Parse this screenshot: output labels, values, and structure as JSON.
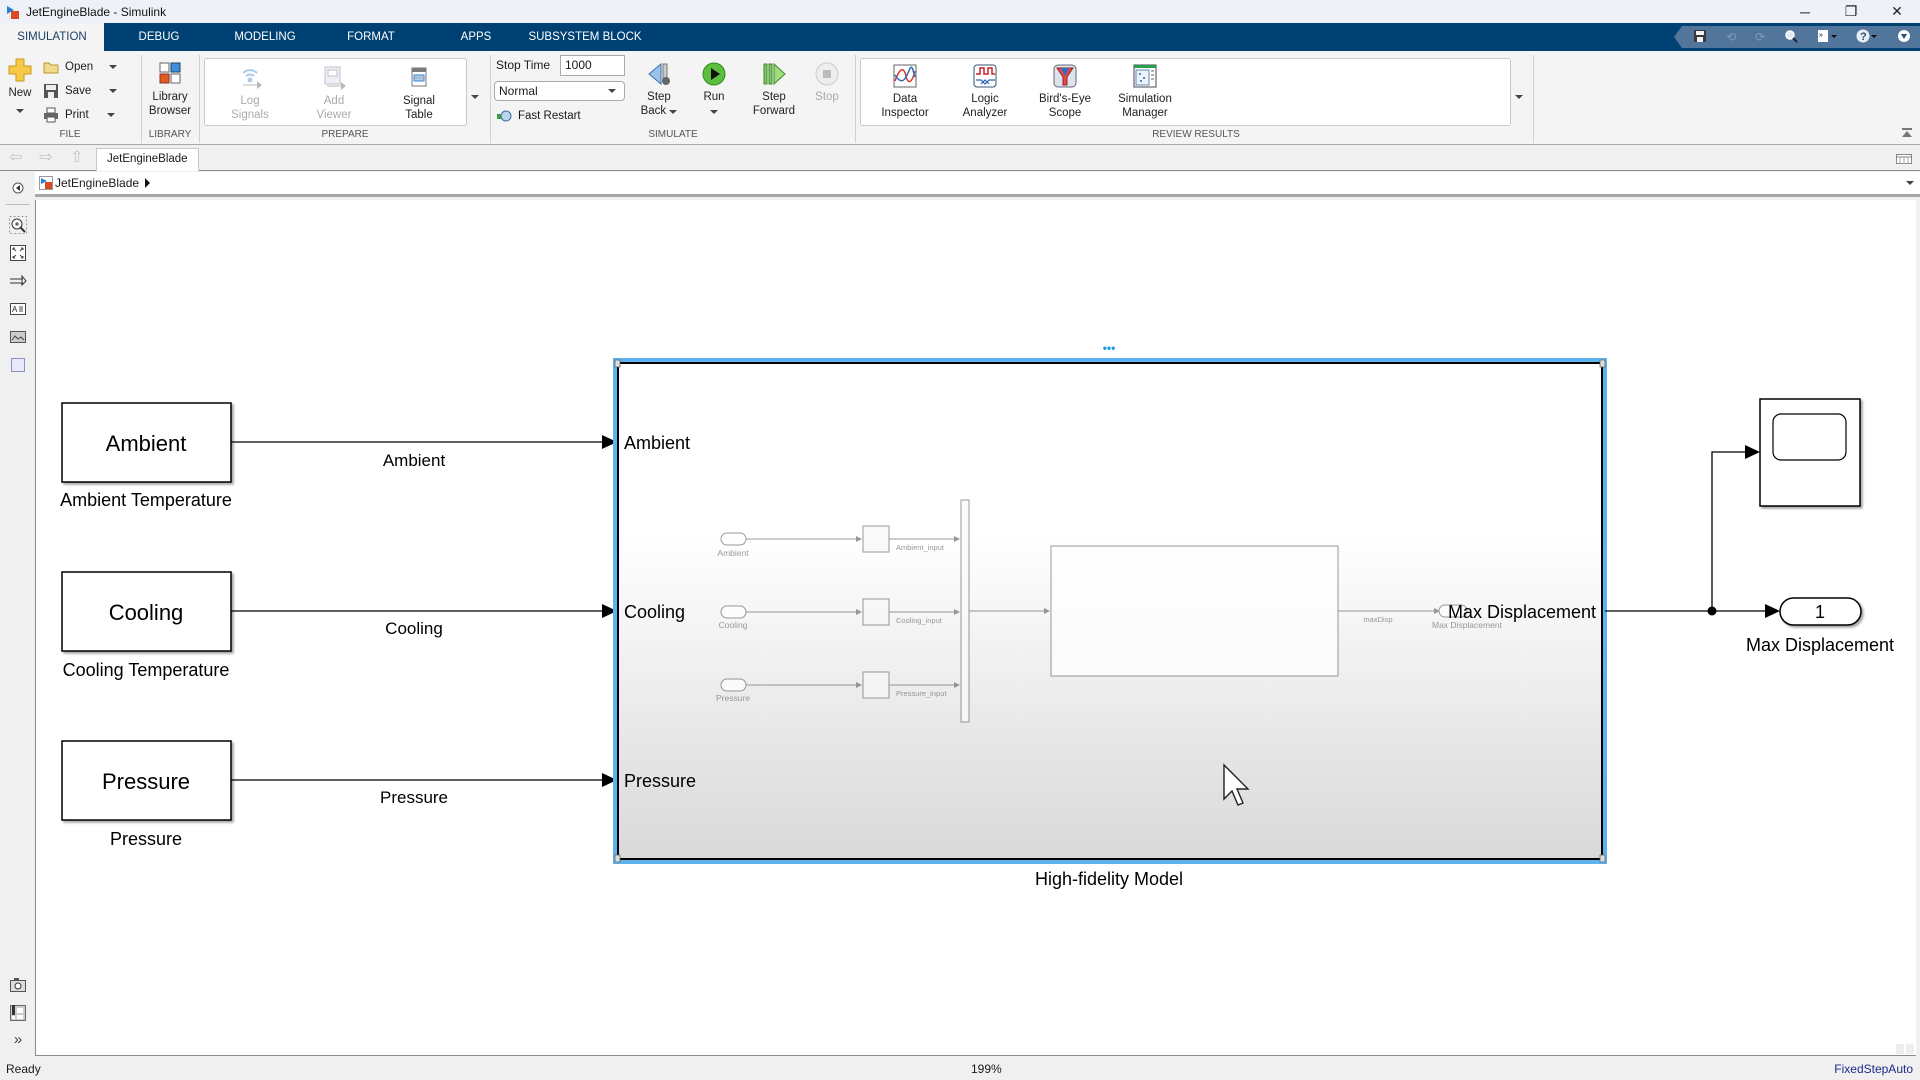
{
  "window": {
    "title": "JetEngineBlade - Simulink",
    "controls": {
      "minimize": "─",
      "restore": "❐",
      "close": "✕"
    }
  },
  "ribbon": {
    "tabs": [
      {
        "label": "SIMULATION",
        "active": true
      },
      {
        "label": "DEBUG",
        "active": false
      },
      {
        "label": "MODELING",
        "active": false
      },
      {
        "label": "FORMAT",
        "active": false
      },
      {
        "label": "APPS",
        "active": false
      },
      {
        "label": "SUBSYSTEM BLOCK",
        "active": false
      }
    ],
    "quick_access": [
      "save-icon",
      "undo-icon",
      "redo-icon",
      "search-icon",
      "shortcut-icon",
      "help-icon",
      "collapse-icon"
    ],
    "sections": {
      "file": {
        "label": "FILE",
        "new_label": "New",
        "open_label": "Open",
        "save_label": "Save",
        "print_label": "Print"
      },
      "library": {
        "label": "LIBRARY",
        "library_browser_line1": "Library",
        "library_browser_line2": "Browser"
      },
      "prepare": {
        "label": "PREPARE",
        "log_signals_line1": "Log",
        "log_signals_line2": "Signals",
        "add_viewer_line1": "Add",
        "add_viewer_line2": "Viewer",
        "signal_table_line1": "Signal",
        "signal_table_line2": "Table"
      },
      "simulate": {
        "label": "SIMULATE",
        "stop_time_label": "Stop Time",
        "stop_time_value": "1000",
        "mode_value": "Normal",
        "fast_restart_label": "Fast Restart",
        "step_back_line1": "Step",
        "step_back_line2": "Back",
        "run_label": "Run",
        "step_forward_line1": "Step",
        "step_forward_line2": "Forward",
        "stop_label": "Stop"
      },
      "review_results": {
        "label": "REVIEW RESULTS",
        "data_inspector_line1": "Data",
        "data_inspector_line2": "Inspector",
        "logic_analyzer_line1": "Logic",
        "logic_analyzer_line2": "Analyzer",
        "birds_eye_line1": "Bird's-Eye",
        "birds_eye_line2": "Scope",
        "sim_manager_line1": "Simulation",
        "sim_manager_line2": "Manager"
      }
    }
  },
  "navigation": {
    "model_tab": "JetEngineBlade",
    "breadcrumb": "JetEngineBlade"
  },
  "diagram": {
    "sources": [
      {
        "block_text": "Ambient",
        "name": "Ambient Temperature",
        "signal": "Ambient"
      },
      {
        "block_text": "Cooling",
        "name": "Cooling Temperature",
        "signal": "Cooling"
      },
      {
        "block_text": "Pressure",
        "name": "Pressure",
        "signal": "Pressure"
      }
    ],
    "subsystem": {
      "name": "High-fidelity Model",
      "in_ports": [
        "Ambient",
        "Cooling",
        "Pressure"
      ],
      "out_port": "Max Displacement",
      "preview": {
        "inports": [
          "Ambient",
          "Cooling",
          "Pressure"
        ],
        "signals": [
          "Ambient_input",
          "Cooling_input",
          "Pressure_input"
        ],
        "out_signal": "maxDisp",
        "outport": "Max Displacement"
      },
      "more_indicator": "•••"
    },
    "outport": {
      "number": "1",
      "name": "Max Displacement"
    },
    "scope": {
      "name": ""
    }
  },
  "status": {
    "left": "Ready",
    "zoom": "199%",
    "solver": "FixedStepAuto"
  }
}
